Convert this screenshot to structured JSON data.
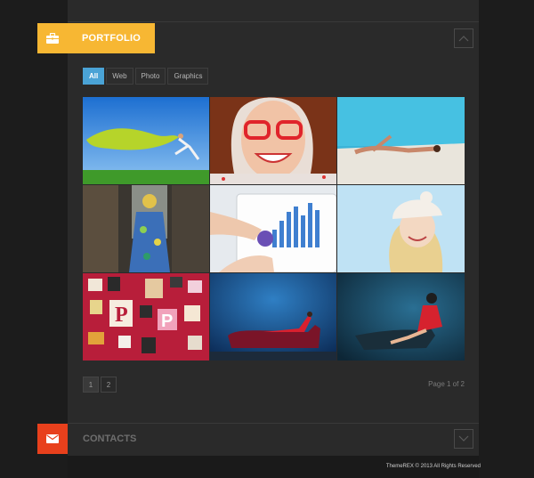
{
  "portfolio": {
    "title": "PORTFOLIO",
    "icon": "briefcase-icon",
    "accent": "#f7b733",
    "filters": [
      {
        "label": "All",
        "active": true
      },
      {
        "label": "Web",
        "active": false
      },
      {
        "label": "Photo",
        "active": false
      },
      {
        "label": "Graphics",
        "active": false
      }
    ],
    "items": [
      {
        "subject": "woman leaping in field with green scarf"
      },
      {
        "subject": "smiling woman with red glasses"
      },
      {
        "subject": "woman sunbathing by pool"
      },
      {
        "subject": "woman in floral dress in city"
      },
      {
        "subject": "hands on tablet with chart"
      },
      {
        "subject": "smiling woman in white knit hat"
      },
      {
        "subject": "wall of letter P designs"
      },
      {
        "subject": "woman in red dress on sofa"
      },
      {
        "subject": "woman in red dress sitting"
      }
    ],
    "pages": [
      "1",
      "2"
    ],
    "page_info": "Page 1 of 2"
  },
  "contacts": {
    "title": "CONTACTS",
    "icon": "envelope-icon",
    "accent": "#e8401c"
  },
  "footer": {
    "copyright": "ThemeREX © 2013 All Rights Reserved"
  }
}
